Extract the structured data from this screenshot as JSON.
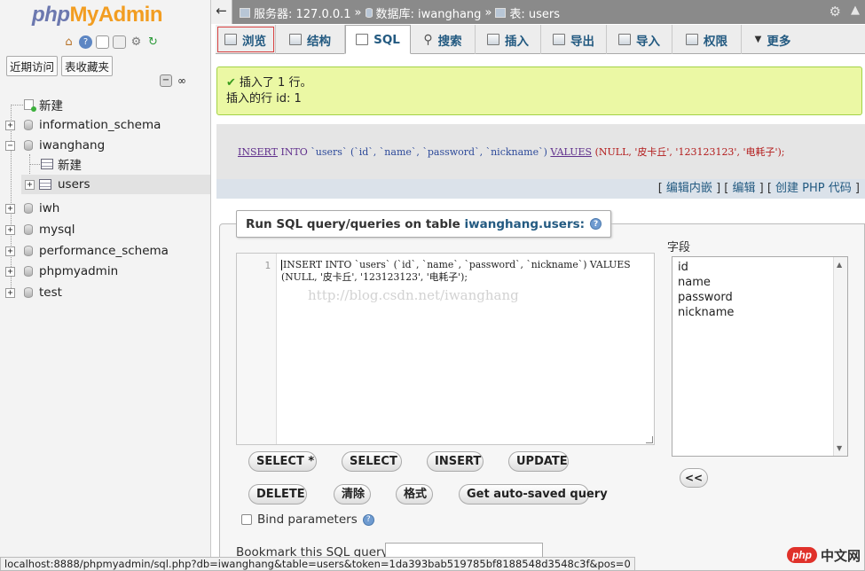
{
  "logo": {
    "part1": "php",
    "part2": "MyAdmin"
  },
  "nav": {
    "tabs": [
      "近期访问",
      "表收藏夹"
    ],
    "tree": {
      "new_label": "新建",
      "databases": [
        {
          "name": "information_schema"
        },
        {
          "name": "iwanghang",
          "new_label": "新建",
          "table": "users"
        },
        {
          "name": "iwh"
        },
        {
          "name": "mysql"
        },
        {
          "name": "performance_schema"
        },
        {
          "name": "phpmyadmin"
        },
        {
          "name": "test"
        }
      ]
    }
  },
  "breadcrumb": {
    "server_label": "服务器: 127.0.0.1",
    "database_label": "数据库: iwanghang",
    "table_label": "表: users",
    "sep": "»"
  },
  "menu": {
    "browse": "浏览",
    "structure": "结构",
    "sql": "SQL",
    "search": "搜索",
    "insert": "插入",
    "export": "导出",
    "import": "导入",
    "privileges": "权限",
    "more": "更多"
  },
  "message": {
    "line1": "插入了 1 行。",
    "line2": "插入的行 id: 1"
  },
  "executed_sql": {
    "kw1": "INSERT",
    "kw2": "INTO",
    "table": "`users`",
    "columns": "(`id`, `name`, `password`, `nickname`)",
    "kw3": "VALUES",
    "values": "(NULL, '皮卡丘', '123123123', '电耗子');"
  },
  "sql_links": {
    "inline_edit": "编辑内嵌",
    "edit": "编辑",
    "create_php": "创建 PHP 代码"
  },
  "query_box": {
    "title_prefix": "Run SQL query/queries on table ",
    "title_table": "iwanghang.users:",
    "line_number": "1",
    "code_line1": "INSERT INTO `users` (`id`, `name`, `password`, `nickname`) VALUES",
    "code_line2": "(NULL, '皮卡丘', '123123123', '电耗子');",
    "watermark": "http://blog.csdn.net/iwanghang"
  },
  "fields": {
    "title": "字段",
    "items": [
      "id",
      "name",
      "password",
      "nickname"
    ],
    "add_button": "<<"
  },
  "buttons": {
    "select_star": "SELECT *",
    "select": "SELECT",
    "insert": "INSERT",
    "update": "UPDATE",
    "delete": "DELETE",
    "clear": "清除",
    "format": "格式",
    "autosaved": "Get auto-saved query"
  },
  "bind_label": "Bind parameters",
  "bookmark_label": "Bookmark this SQL query:",
  "status_url": "localhost:8888/phpmyadmin/sql.php?db=iwanghang&table=users&token=1da393bab519785bf8188548d3548c3f&pos=0",
  "brand": {
    "badge": "php",
    "text": "中文网"
  }
}
